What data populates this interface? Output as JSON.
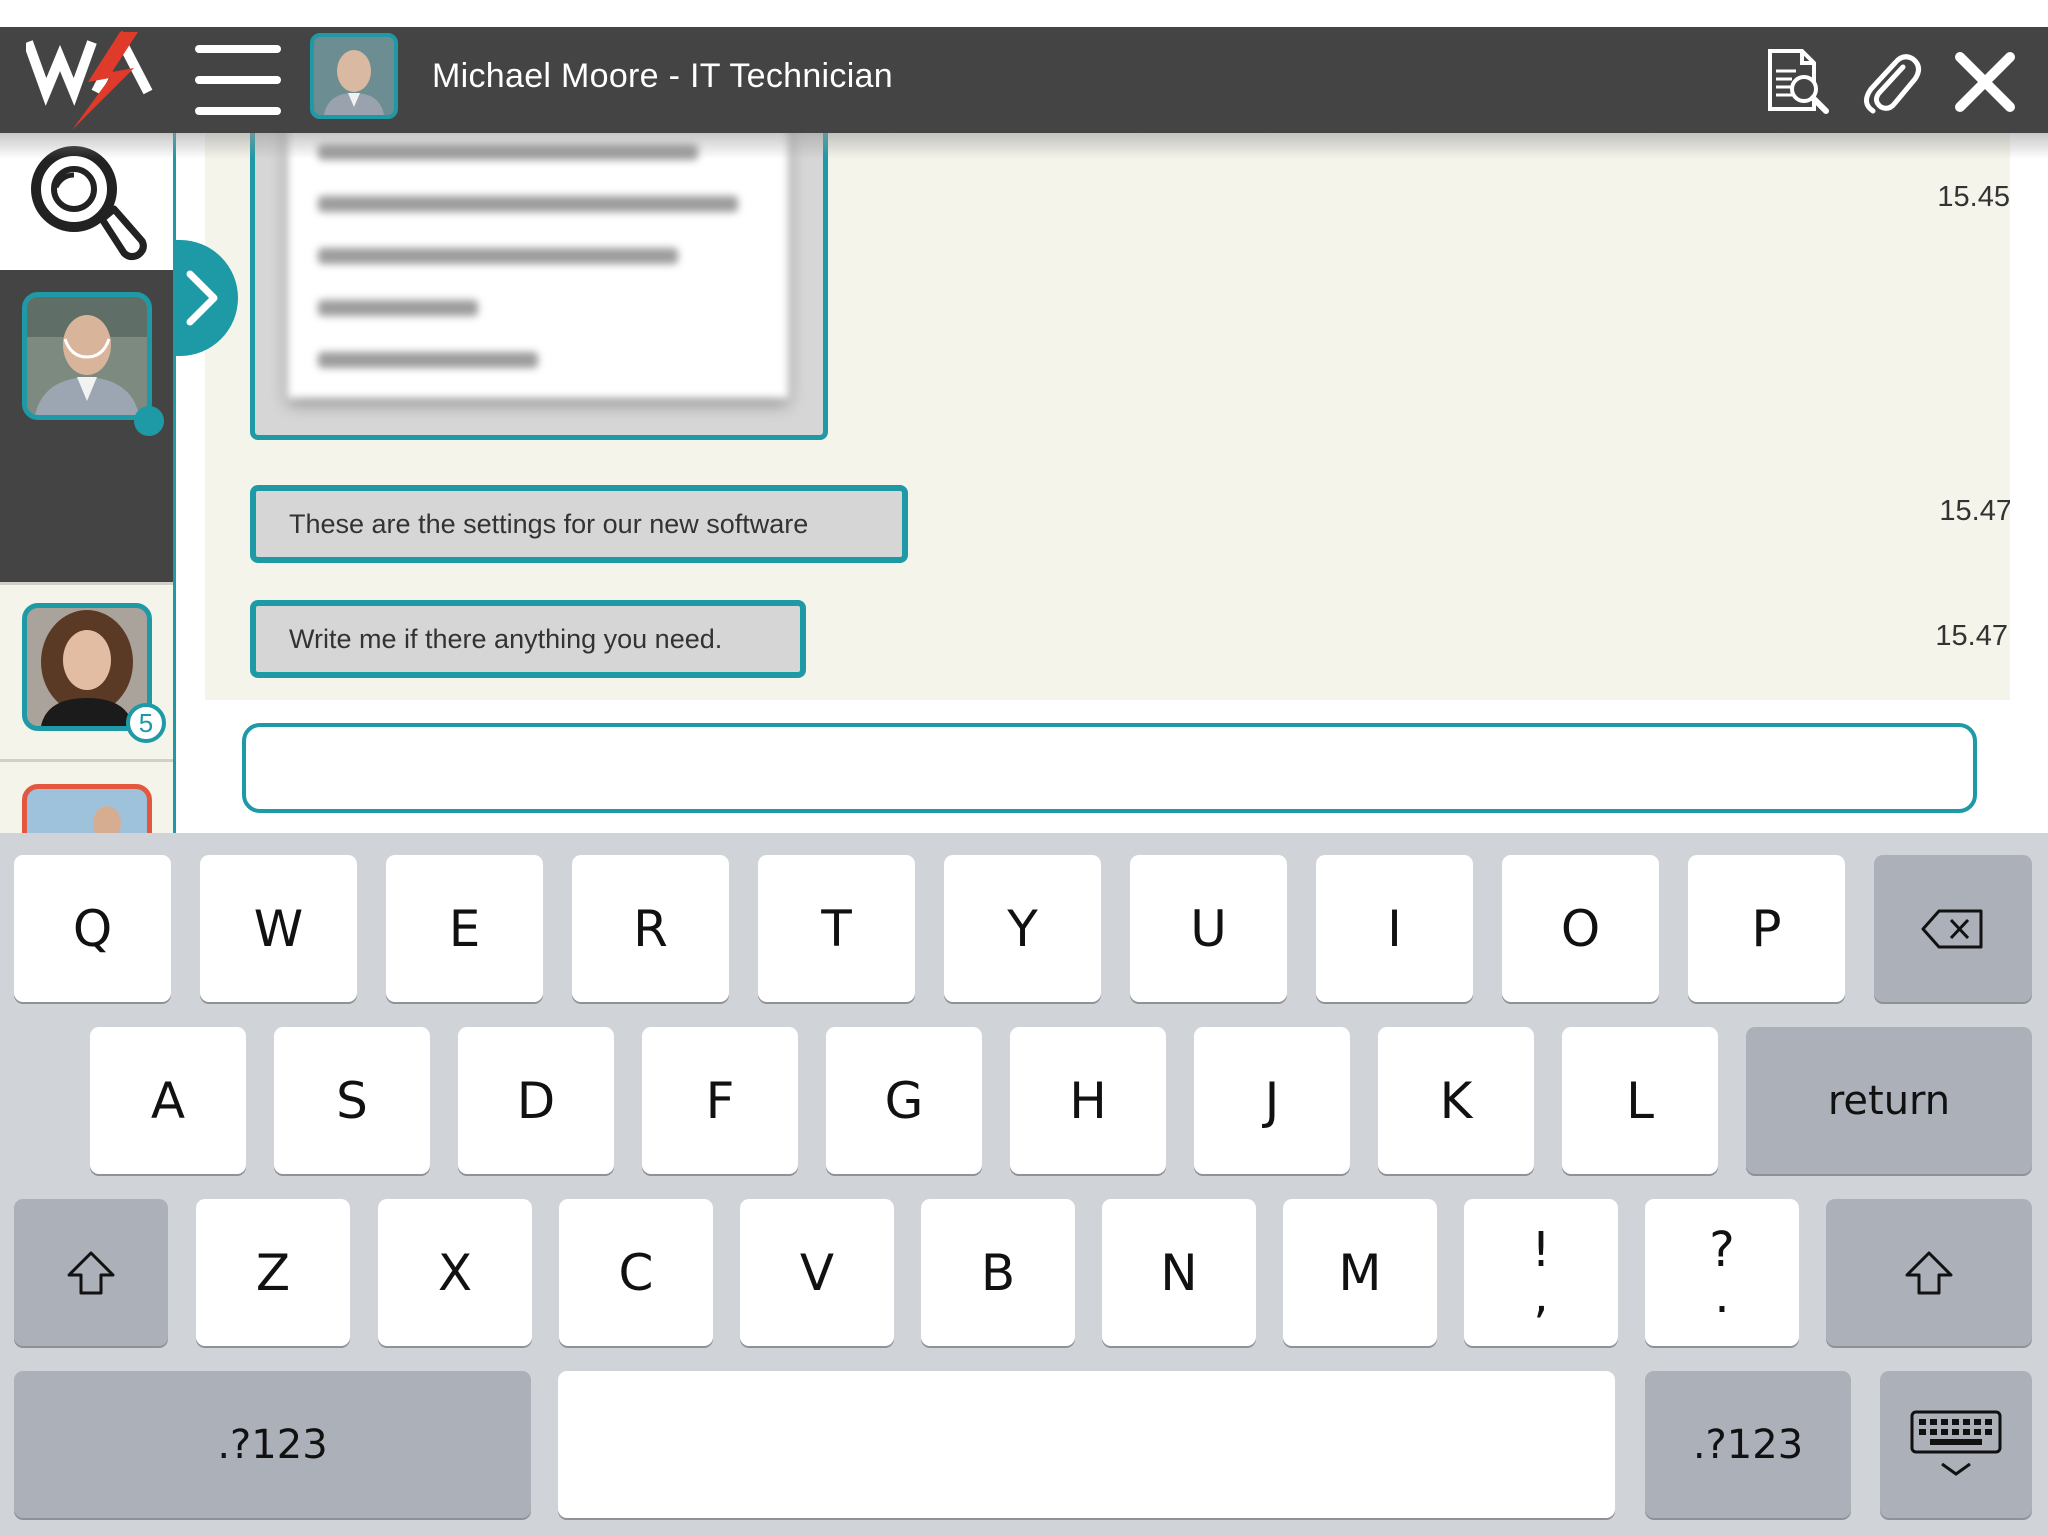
{
  "header": {
    "title": "Michael Moore - IT Technician",
    "logo_icon": "wa-lightning-logo",
    "icons": [
      "menu-icon",
      "document-search-icon",
      "paperclip-icon",
      "close-icon"
    ]
  },
  "sidebar": {
    "search_icon": "magnifier-icon",
    "contacts": [
      {
        "name": "contact-michael",
        "status": "online",
        "active": true
      },
      {
        "name": "contact-woman",
        "unread": "5"
      },
      {
        "name": "contact-starred",
        "starred": true
      }
    ],
    "expand_icon": "chevron-right-icon"
  },
  "chat": {
    "messages": [
      {
        "type": "image",
        "time": "15.45"
      },
      {
        "type": "text",
        "text": "These are the settings for our new software",
        "time": "15.47"
      },
      {
        "type": "text",
        "text": "Write me if there anything you need.",
        "time": "15.47"
      }
    ],
    "compose": {
      "value": "",
      "placeholder": ""
    }
  },
  "keyboard": {
    "row1": [
      "Q",
      "W",
      "E",
      "R",
      "T",
      "Y",
      "U",
      "I",
      "O",
      "P"
    ],
    "row2": [
      "A",
      "S",
      "D",
      "F",
      "G",
      "H",
      "J",
      "K",
      "L"
    ],
    "return_label": "return",
    "row3": [
      "Z",
      "X",
      "C",
      "V",
      "B",
      "N",
      "M"
    ],
    "punct1": {
      "top": "!",
      "bottom": ","
    },
    "punct2": {
      "top": "?",
      "bottom": "."
    },
    "numbers_label": ".?123",
    "colors": {
      "accent": "#1d9aa6",
      "bar": "#444444",
      "chat_bg": "#f4f4ea"
    }
  }
}
